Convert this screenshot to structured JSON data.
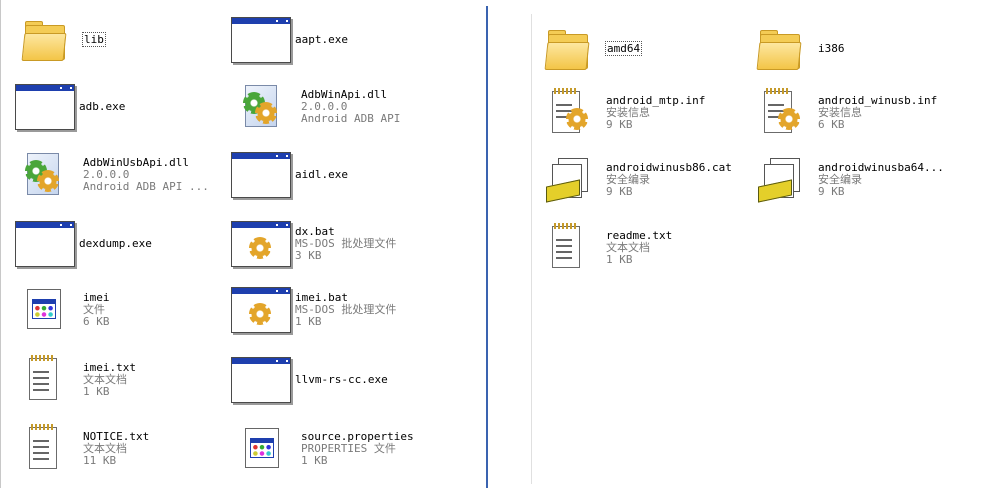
{
  "left": {
    "items": [
      {
        "name": "lib",
        "type": "folder",
        "selected": true
      },
      {
        "name": "aapt.exe",
        "type": "exe"
      },
      {
        "name": "adb.exe",
        "type": "exe"
      },
      {
        "name": "AdbWinApi.dll",
        "line2": "2.0.0.0",
        "line3": "Android ADB API",
        "type": "dll"
      },
      {
        "name": "AdbWinUsbApi.dll",
        "line2": "2.0.0.0",
        "line3": "Android ADB API ...",
        "type": "dll"
      },
      {
        "name": "aidl.exe",
        "type": "exe"
      },
      {
        "name": "dexdump.exe",
        "type": "exe"
      },
      {
        "name": "dx.bat",
        "line2": "MS-DOS 批处理文件",
        "line3": "3 KB",
        "type": "bat"
      },
      {
        "name": "imei",
        "line2": "文件",
        "line3": "6 KB",
        "type": "app"
      },
      {
        "name": "imei.bat",
        "line2": "MS-DOS 批处理文件",
        "line3": "1 KB",
        "type": "bat"
      },
      {
        "name": "imei.txt",
        "line2": "文本文档",
        "line3": "1 KB",
        "type": "txt"
      },
      {
        "name": "llvm-rs-cc.exe",
        "type": "exe"
      },
      {
        "name": "NOTICE.txt",
        "line2": "文本文档",
        "line3": "11 KB",
        "type": "txt"
      },
      {
        "name": "source.properties",
        "line2": "PROPERTIES 文件",
        "line3": "1 KB",
        "type": "app"
      }
    ]
  },
  "right": {
    "items": [
      {
        "name": "amd64",
        "type": "folder",
        "selected": true
      },
      {
        "name": "i386",
        "type": "folder"
      },
      {
        "name": "android_mtp.inf",
        "line2": "安装信息",
        "line3": "9 KB",
        "type": "inf"
      },
      {
        "name": "android_winusb.inf",
        "line2": "安装信息",
        "line3": "6 KB",
        "type": "inf"
      },
      {
        "name": "androidwinusb86.cat",
        "line2": "安全编录",
        "line3": "9 KB",
        "type": "cat"
      },
      {
        "name": "androidwinusba64...",
        "line2": "安全编录",
        "line3": "9 KB",
        "type": "cat"
      },
      {
        "name": "readme.txt",
        "line2": "文本文档",
        "line3": "1 KB",
        "type": "txt"
      }
    ]
  }
}
